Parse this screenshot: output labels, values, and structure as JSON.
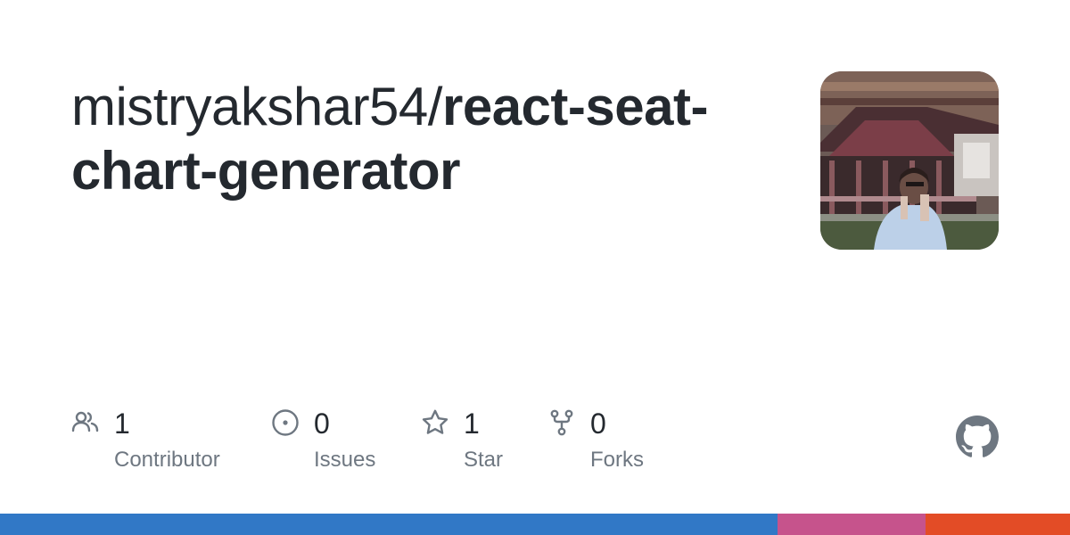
{
  "repo": {
    "owner": "mistryakshar54/",
    "name": "react-seat-chart-generator"
  },
  "stats": [
    {
      "count": "1",
      "label": "Contributor",
      "icon": "people-icon"
    },
    {
      "count": "0",
      "label": "Issues",
      "icon": "issue-icon"
    },
    {
      "count": "1",
      "label": "Star",
      "icon": "star-icon"
    },
    {
      "count": "0",
      "label": "Forks",
      "icon": "fork-icon"
    }
  ],
  "colors": {
    "text": "#24292f",
    "muted": "#6e7781",
    "icon": "#6e7781",
    "github_mark": "#6e7781"
  },
  "language_bar": [
    {
      "color": "#3178c6",
      "fraction": 0.727
    },
    {
      "color": "#c6538c",
      "fraction": 0.138
    },
    {
      "color": "#e34c26",
      "fraction": 0.135
    }
  ],
  "icons": {
    "avatar": "owner-avatar",
    "brand": "github-mark-icon"
  }
}
